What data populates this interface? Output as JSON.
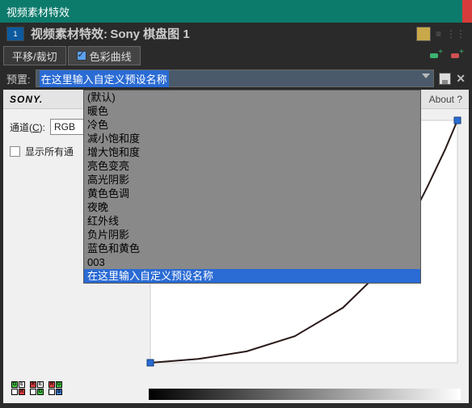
{
  "window": {
    "title": "视频素材特效"
  },
  "subheader": {
    "doc_badge": "1",
    "label": "视频素材特效:",
    "item_name": "Sony 棋盘图 1"
  },
  "tabs": {
    "crop": "平移/裁切",
    "curves": "色彩曲线"
  },
  "preset_row": {
    "label": "预置:",
    "current": "在这里输入自定义预设名称"
  },
  "dropdown": {
    "items": [
      "(默认)",
      "暖色",
      "冷色",
      "减小饱和度",
      "增大饱和度",
      "亮色变亮",
      "高光阴影",
      "黄色色调",
      "夜晚",
      "红外线",
      "负片阴影",
      "蓝色和黄色",
      "003",
      "在这里输入自定义预设名称"
    ],
    "selected_index": 13
  },
  "panel": {
    "brand": "SONY.",
    "about": "About  ?",
    "channel_label_pre": "通道(",
    "channel_label_u": "C",
    "channel_label_post": "):",
    "channel_value": "RGB",
    "show_all_label": "显示所有通"
  },
  "chart_data": {
    "type": "line",
    "title": "",
    "xlabel": "",
    "ylabel": "",
    "xlim": [
      0,
      255
    ],
    "ylim": [
      0,
      255
    ],
    "series": [
      {
        "name": "RGB",
        "x": [
          0,
          40,
          80,
          120,
          160,
          190,
          210,
          230,
          245,
          255
        ],
        "values": [
          0,
          4,
          12,
          28,
          58,
          95,
          135,
          185,
          225,
          255
        ]
      }
    ],
    "control_points": [
      {
        "x": 0,
        "y": 0
      },
      {
        "x": 255,
        "y": 255
      }
    ]
  }
}
